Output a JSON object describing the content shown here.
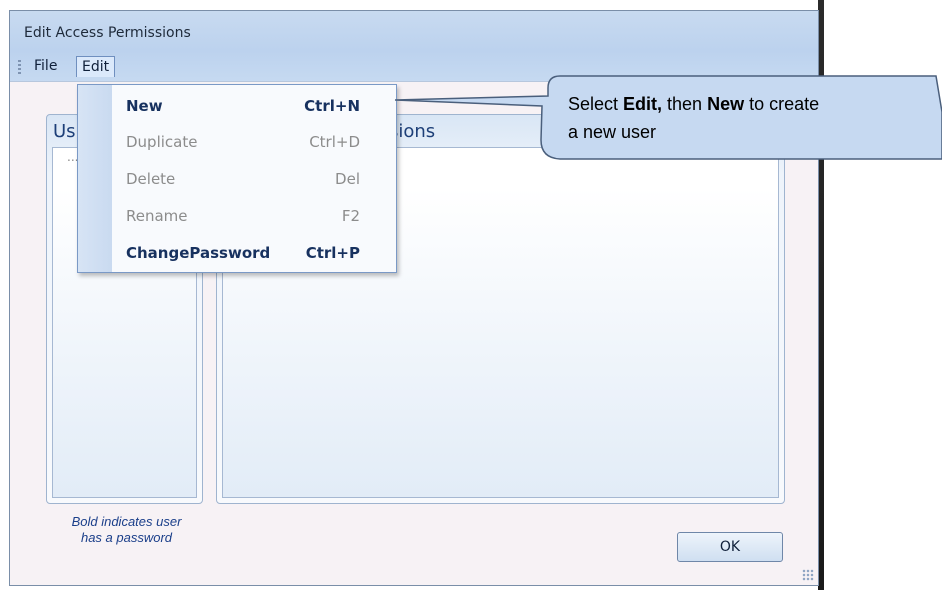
{
  "window": {
    "title": "Edit Access Permissions"
  },
  "menu": {
    "file": "File",
    "edit": "Edit"
  },
  "panels": {
    "users_header": "Us",
    "permissions_header": "sions",
    "users_placeholder": "..."
  },
  "edit_menu": {
    "items": [
      {
        "label": "New",
        "shortcut": "Ctrl+N",
        "enabled": true
      },
      {
        "label": "Duplicate",
        "shortcut": "Ctrl+D",
        "enabled": false
      },
      {
        "label": "Delete",
        "shortcut": "Del",
        "enabled": false
      },
      {
        "label": "Rename",
        "shortcut": "F2",
        "enabled": false
      },
      {
        "label": "ChangePassword",
        "shortcut": "Ctrl+P",
        "enabled": true
      }
    ]
  },
  "legend": {
    "line1": "Bold indicates user",
    "line2": "has a password"
  },
  "buttons": {
    "ok": "OK"
  },
  "callout": {
    "part1": "Select ",
    "bold1": "Edit,",
    "part2": " then ",
    "bold2": "New",
    "part3": " to create",
    "line2": "a new user"
  },
  "colors": {
    "callout_fill": "#c6d9f1",
    "accent_text": "#17315f",
    "legend_text": "#1b3f8a"
  }
}
